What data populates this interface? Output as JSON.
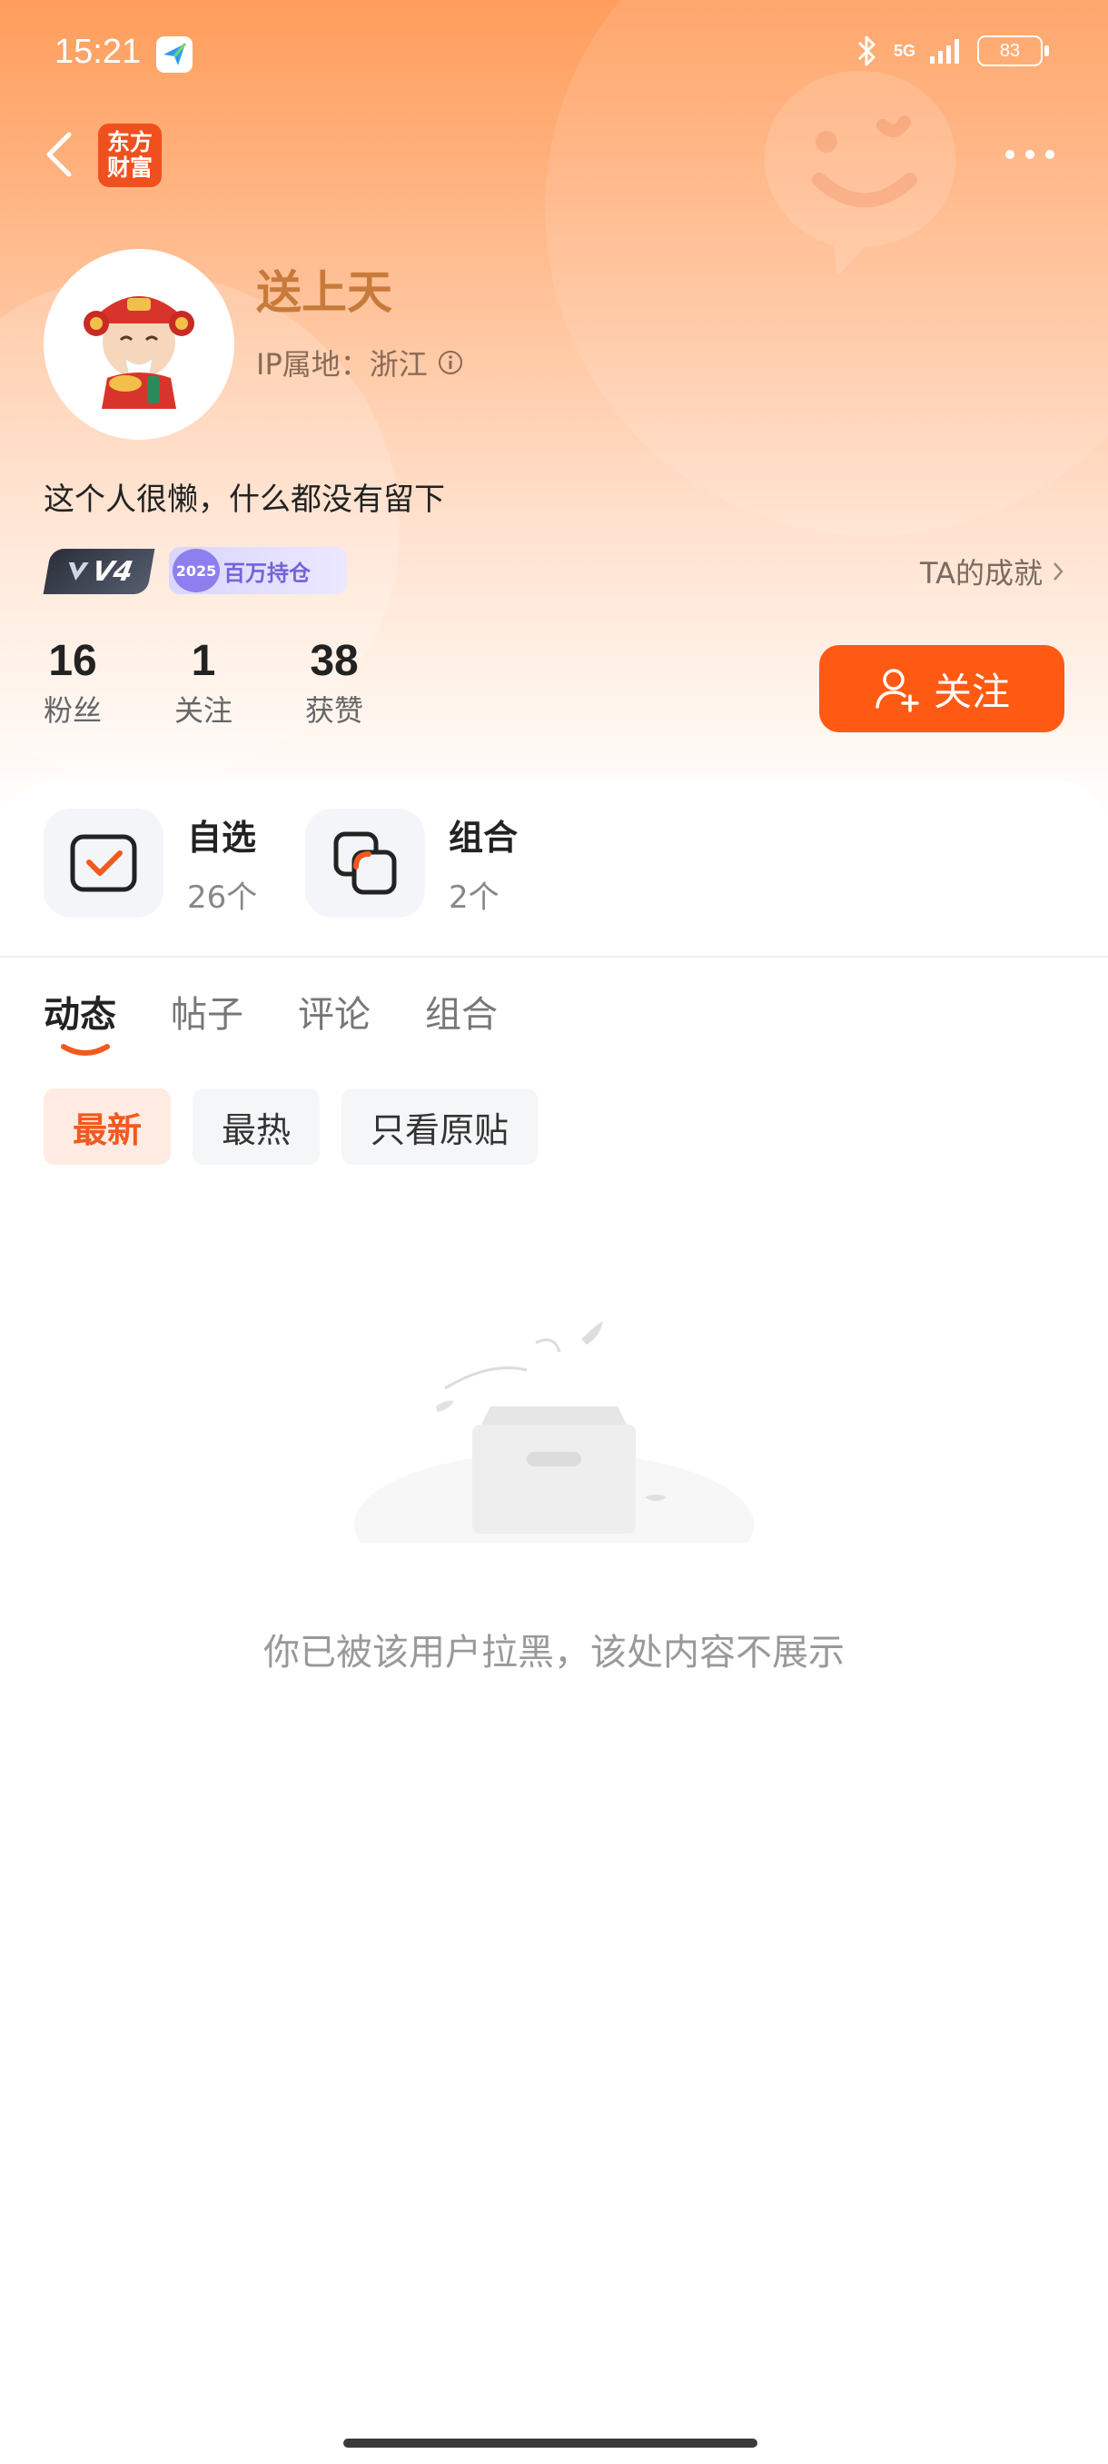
{
  "status_bar": {
    "time": "15:21",
    "network": "5G",
    "battery": "83"
  },
  "nav": {
    "logo_line1": "东方",
    "logo_line2": "财富"
  },
  "profile": {
    "username": "送上天",
    "ip_label": "IP属地：浙江",
    "bio": "这个人很懒，什么都没有留下",
    "level_badge": "V4",
    "holding_badge_year": "2025",
    "holding_badge_text": "百万持仓",
    "achievement_link": "TA的成就"
  },
  "stats": [
    {
      "value": "16",
      "label": "粉丝"
    },
    {
      "value": "1",
      "label": "关注"
    },
    {
      "value": "38",
      "label": "获赞"
    }
  ],
  "follow_button": "关注",
  "features": [
    {
      "title": "自选",
      "count": "26个"
    },
    {
      "title": "组合",
      "count": "2个"
    }
  ],
  "tabs": [
    "动态",
    "帖子",
    "评论",
    "组合"
  ],
  "filters": [
    "最新",
    "最热",
    "只看原贴"
  ],
  "empty_message": "你已被该用户拉黑，该处内容不展示",
  "colors": {
    "accent": "#ff5a14",
    "username": "#c77a3a"
  }
}
